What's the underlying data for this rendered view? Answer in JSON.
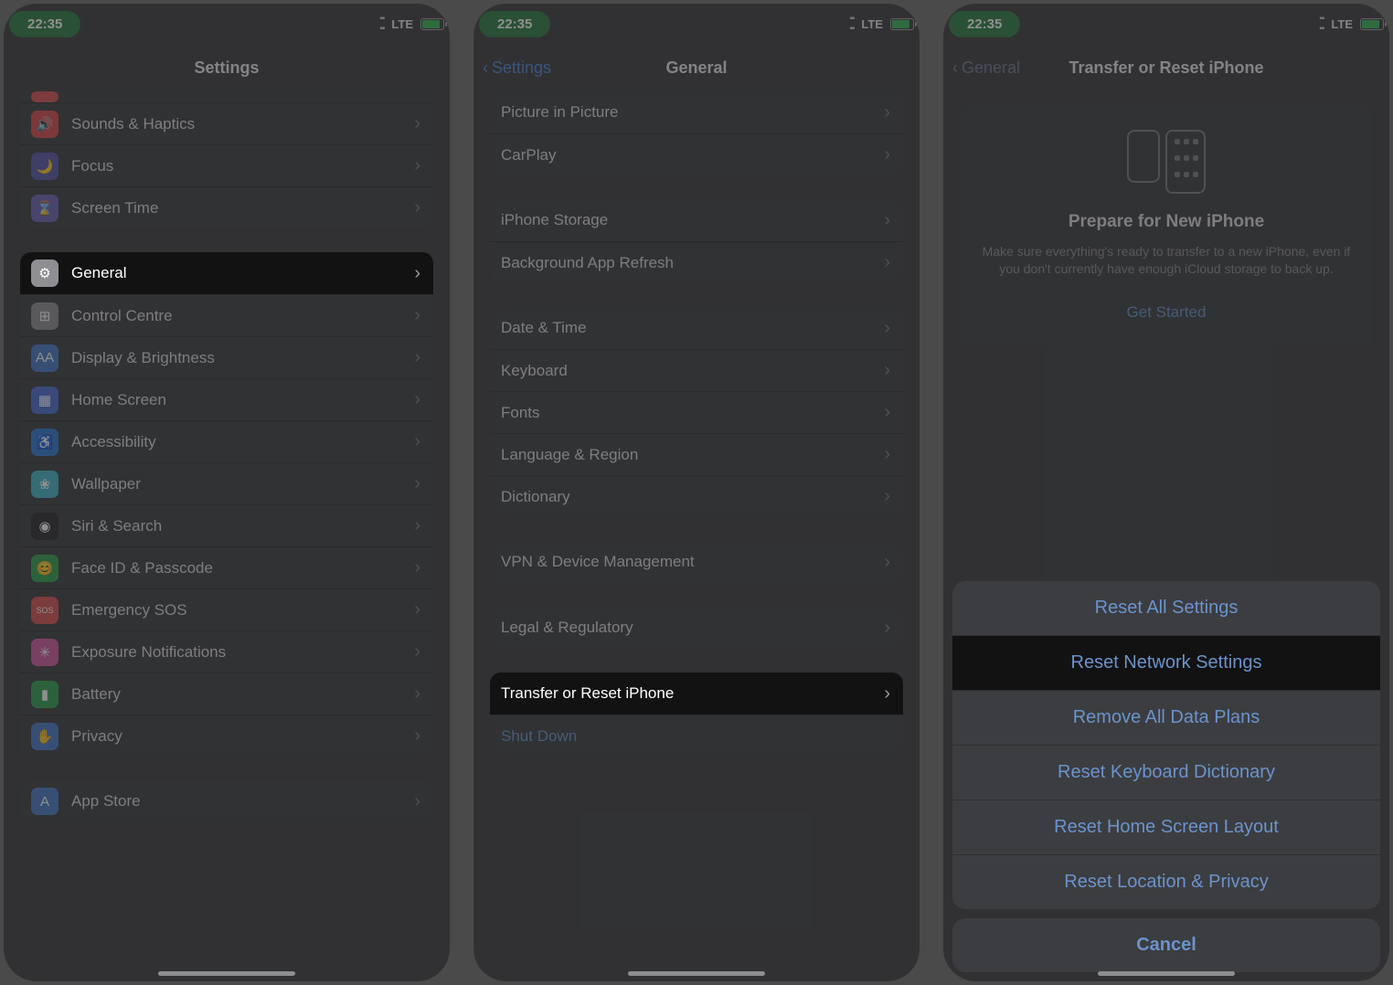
{
  "status": {
    "time": "22:35",
    "network": "LTE"
  },
  "screen1": {
    "title": "Settings",
    "rows": [
      {
        "label": "Sounds & Haptics",
        "iconBg": "#da4a4a",
        "iconGlyph": "🔊"
      },
      {
        "label": "Focus",
        "iconBg": "#5856a8",
        "iconGlyph": "🌙"
      },
      {
        "label": "Screen Time",
        "iconBg": "#6b64b7",
        "iconGlyph": "⌛"
      }
    ],
    "rows2": [
      {
        "label": "General",
        "iconBg": "#8e8e93",
        "iconGlyph": "⚙",
        "hl": true
      },
      {
        "label": "Control Centre",
        "iconBg": "#8e8e93",
        "iconGlyph": "⊞"
      },
      {
        "label": "Display & Brightness",
        "iconBg": "#4a7ac6",
        "iconGlyph": "AA"
      },
      {
        "label": "Home Screen",
        "iconBg": "#4a6ed1",
        "iconGlyph": "▦"
      },
      {
        "label": "Accessibility",
        "iconBg": "#2f7ad0",
        "iconGlyph": "♿"
      },
      {
        "label": "Wallpaper",
        "iconBg": "#45b6c5",
        "iconGlyph": "❀"
      },
      {
        "label": "Siri & Search",
        "iconBg": "#2b2b2d",
        "iconGlyph": "◉"
      },
      {
        "label": "Face ID & Passcode",
        "iconBg": "#30a14e",
        "iconGlyph": "😊"
      },
      {
        "label": "Emergency SOS",
        "iconBg": "#d85050",
        "iconGlyph": "SOS"
      },
      {
        "label": "Exposure Notifications",
        "iconBg": "#d15a9e",
        "iconGlyph": "✳"
      },
      {
        "label": "Battery",
        "iconBg": "#30a14e",
        "iconGlyph": "▮"
      },
      {
        "label": "Privacy",
        "iconBg": "#4a7ac6",
        "iconGlyph": "✋"
      }
    ],
    "rows3": [
      {
        "label": "App Store",
        "iconBg": "#4a7ac6",
        "iconGlyph": "A"
      }
    ]
  },
  "screen2": {
    "back": "Settings",
    "title": "General",
    "g1": [
      "Picture in Picture",
      "CarPlay"
    ],
    "g2": [
      "iPhone Storage",
      "Background App Refresh"
    ],
    "g3": [
      "Date & Time",
      "Keyboard",
      "Fonts",
      "Language & Region",
      "Dictionary"
    ],
    "g4": [
      "VPN & Device Management"
    ],
    "g5": [
      "Legal & Regulatory"
    ],
    "g6": [
      {
        "label": "Transfer or Reset iPhone",
        "hl": true
      },
      {
        "label": "Shut Down",
        "link": true
      }
    ]
  },
  "screen3": {
    "back": "General",
    "title": "Transfer or Reset iPhone",
    "card": {
      "heading": "Prepare for New iPhone",
      "body": "Make sure everything's ready to transfer to a new iPhone, even if you don't currently have enough iCloud storage to back up.",
      "cta": "Get Started"
    },
    "sheet": [
      "Reset All Settings",
      "Reset Network Settings",
      "Remove All Data Plans",
      "Reset Keyboard Dictionary",
      "Reset Home Screen Layout",
      "Reset Location & Privacy"
    ],
    "sheet_hl_index": 1,
    "cancel": "Cancel"
  }
}
